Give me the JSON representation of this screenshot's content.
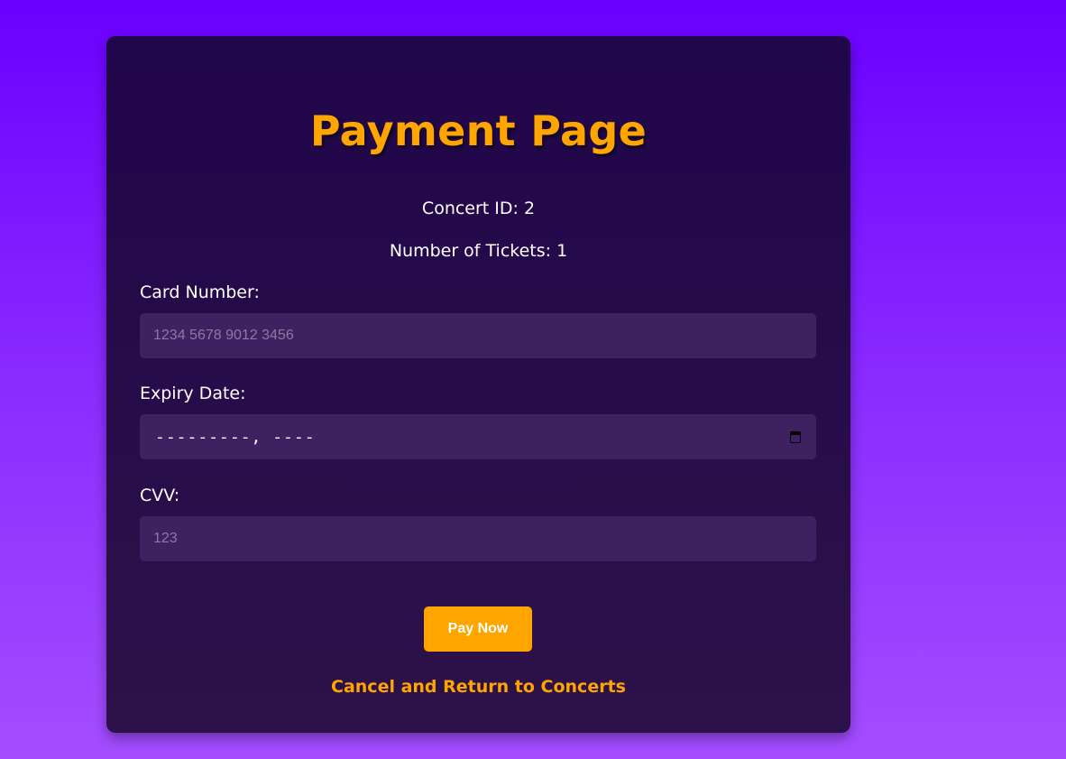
{
  "page": {
    "title": "Payment Page"
  },
  "summary": {
    "concert_id": "Concert ID: 2",
    "tickets": "Number of Tickets: 1"
  },
  "form": {
    "card_number": {
      "label": "Card Number:",
      "placeholder": "1234 5678 9012 3456",
      "value": ""
    },
    "expiry_date": {
      "label": "Expiry Date:",
      "display": "---------, ----",
      "icon": "calendar-icon"
    },
    "cvv": {
      "label": "CVV:",
      "placeholder": "123",
      "value": ""
    }
  },
  "actions": {
    "pay_label": "Pay Now",
    "cancel_label": "Cancel and Return to Concerts"
  },
  "colors": {
    "accent": "#ffa500",
    "card_background": "#20064a",
    "input_background": "#3d2160",
    "page_gradient_top": "#6a00ff",
    "page_gradient_bottom": "#a44dff"
  }
}
